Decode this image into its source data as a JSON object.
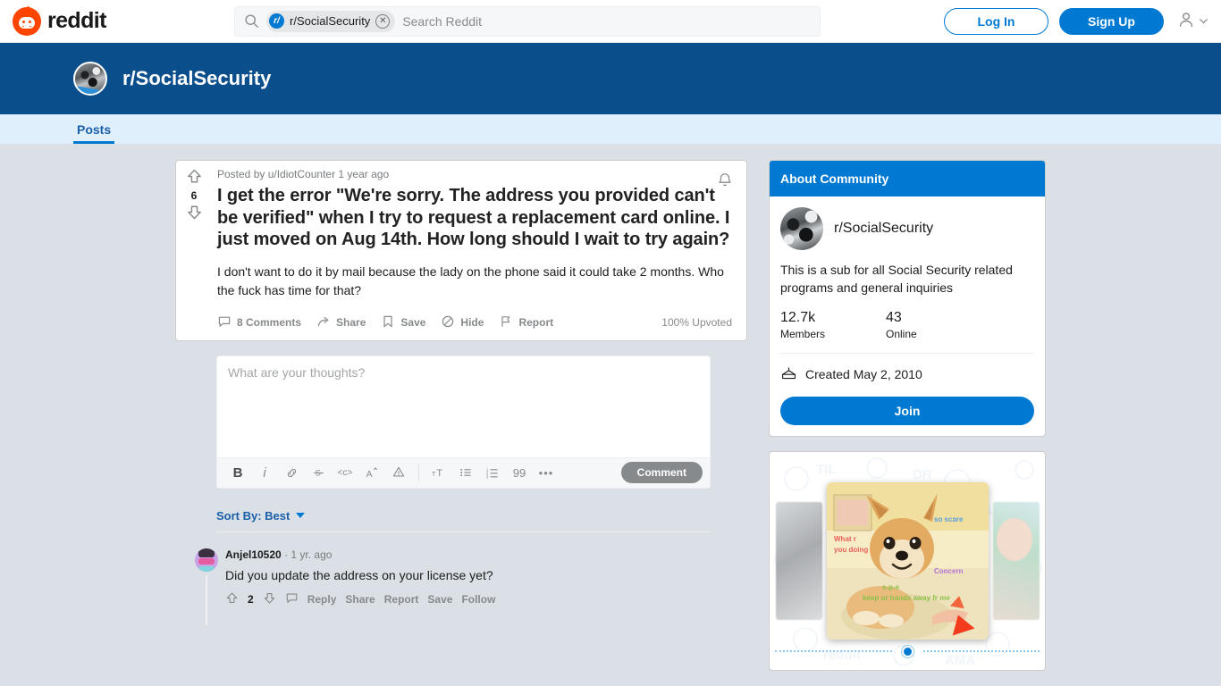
{
  "header": {
    "logo_text": "reddit",
    "search": {
      "chip_label": "r/SocialSecurity",
      "chip_icon_text": "r/",
      "placeholder": "Search Reddit",
      "clear_glyph": "✕"
    },
    "login_label": "Log In",
    "signup_label": "Sign Up"
  },
  "subreddit": {
    "name": "r/SocialSecurity",
    "tabs": [
      {
        "label": "Posts",
        "active": true
      }
    ]
  },
  "post": {
    "meta": "Posted by u/IdiotCounter 1 year ago",
    "title": "I get the error \"We're sorry. The address you provided can't be verified\" when I try to request a replacement card online. I just moved on Aug 14th. How long should I wait to try again?",
    "body": "I don't want to do it by mail because the lady on the phone said it could take 2 months. Who the fuck has time for that?",
    "score": "6",
    "upvoted": "100% Upvoted",
    "actions": [
      {
        "label": "8 Comments",
        "icon": "comment-icon"
      },
      {
        "label": "Share",
        "icon": "share-icon"
      },
      {
        "label": "Save",
        "icon": "bookmark-icon"
      },
      {
        "label": "Hide",
        "icon": "hide-icon"
      },
      {
        "label": "Report",
        "icon": "flag-icon"
      }
    ]
  },
  "composer": {
    "placeholder": "What are your thoughts?",
    "submit_label": "Comment",
    "toolbar": [
      {
        "name": "bold-icon",
        "glyph": "B"
      },
      {
        "name": "italic-icon",
        "glyph": "i"
      },
      {
        "name": "link-icon",
        "glyph": "🔗"
      },
      {
        "name": "strikethrough-icon",
        "glyph": "S"
      },
      {
        "name": "inline-code-icon",
        "glyph": "<c>"
      },
      {
        "name": "superscript-icon",
        "glyph": "A"
      },
      {
        "name": "spoiler-icon",
        "glyph": "!"
      },
      {
        "name": "heading-icon",
        "glyph": "T"
      },
      {
        "name": "bulleted-list-icon",
        "glyph": "☰"
      },
      {
        "name": "numbered-list-icon",
        "glyph": "≡"
      },
      {
        "name": "quote-icon",
        "glyph": "99"
      },
      {
        "name": "more-options-icon",
        "glyph": "•••"
      }
    ]
  },
  "comments_section": {
    "sort_label": "Sort By: Best",
    "comments": [
      {
        "author": "Anjel10520",
        "time": "· 1 yr. ago",
        "text": "Did you update the address on your license yet?",
        "score": "2",
        "actions": [
          "Reply",
          "Share",
          "Report",
          "Save",
          "Follow"
        ]
      }
    ]
  },
  "sidebar": {
    "about": {
      "heading": "About Community",
      "name": "r/SocialSecurity",
      "description": "This is a sub for all Social Security related programs and general inquiries",
      "members_value": "12.7k",
      "members_label": "Members",
      "online_value": "43",
      "online_label": "Online",
      "created": "Created May 2, 2010",
      "join_label": "Join"
    },
    "carousel": {
      "meme_texts": [
        "What r",
        "you doing",
        "so scare",
        "Concern",
        "s-p-e",
        "keep ur hands away fr me"
      ]
    }
  },
  "colors": {
    "reddit_orange": "#ff4500",
    "reddit_blue": "#0079d3",
    "banner_blue": "#0b4e8c",
    "tabbar_blue": "#dfeffc",
    "page_bg": "#dae0e6"
  }
}
